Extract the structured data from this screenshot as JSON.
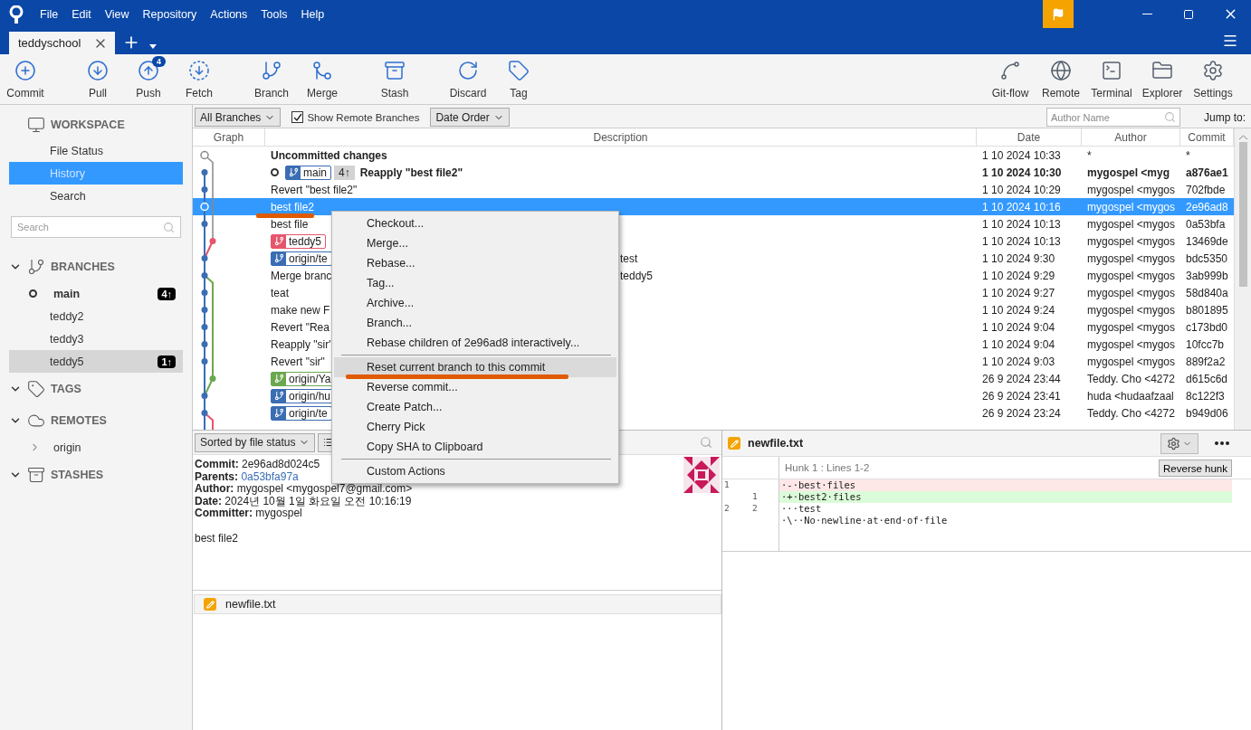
{
  "window": {
    "menu": [
      "File",
      "Edit",
      "View",
      "Repository",
      "Actions",
      "Tools",
      "Help"
    ],
    "tabs": [
      {
        "label": "teddyschool",
        "selected": true
      }
    ]
  },
  "toolbar": {
    "left": [
      {
        "label": "Commit"
      },
      {
        "label": "Pull"
      },
      {
        "label": "Push",
        "badge": "4"
      },
      {
        "label": "Fetch"
      },
      {
        "label": "Branch"
      },
      {
        "label": "Merge"
      },
      {
        "label": "Stash"
      },
      {
        "label": "Discard"
      },
      {
        "label": "Tag"
      }
    ],
    "right": [
      {
        "label": "Git-flow"
      },
      {
        "label": "Remote"
      },
      {
        "label": "Terminal"
      },
      {
        "label": "Explorer"
      },
      {
        "label": "Settings"
      }
    ]
  },
  "sidebar": {
    "workspace": {
      "title": "WORKSPACE",
      "items": [
        {
          "label": "File Status",
          "selected": false
        },
        {
          "label": "History",
          "selected": true
        },
        {
          "label": "Search",
          "selected": false
        }
      ]
    },
    "search": {
      "placeholder": "Search"
    },
    "sections": [
      {
        "title": "BRANCHES",
        "expanded": true,
        "items": [
          {
            "label": "main",
            "current": true,
            "selected": false,
            "badge": "4↑"
          },
          {
            "label": "teddy2",
            "current": false,
            "selected": false
          },
          {
            "label": "teddy3",
            "current": false,
            "selected": false
          },
          {
            "label": "teddy5",
            "current": false,
            "selected": true,
            "badge": "1↑"
          }
        ]
      },
      {
        "title": "TAGS",
        "expanded": true
      },
      {
        "title": "REMOTES",
        "expanded": true,
        "items": [
          {
            "label": "origin",
            "expanded": false
          }
        ]
      },
      {
        "title": "STASHES",
        "expanded": true
      }
    ]
  },
  "history": {
    "filters": {
      "branches": "All Branches",
      "show_remote": {
        "label": "Show Remote Branches",
        "checked": true
      },
      "order": "Date Order",
      "author": {
        "placeholder": "Author Name"
      },
      "jump_label": "Jump to:"
    },
    "columns": [
      "Graph",
      "Description",
      "Date",
      "Author",
      "Commit"
    ],
    "rows": [
      {
        "kind": "uncommitted",
        "selected": false,
        "description": "Uncommitted changes",
        "date": "1 10 2024 10:33",
        "author": "*",
        "commit": "*"
      },
      {
        "kind": "head",
        "selected": false,
        "refs": [
          {
            "kind": "branch",
            "label": "main",
            "color": "#3b6db3"
          },
          {
            "kind": "count",
            "label": "4↑"
          }
        ],
        "description": "Reapply \"best file2\"",
        "date": "1 10 2024 10:30",
        "author": "mygospel <myg",
        "commit": "a876ae1"
      },
      {
        "kind": "commit",
        "selected": false,
        "description": "Revert \"best file2\"",
        "date": "1 10 2024 10:29",
        "author": "mygospel <mygos",
        "commit": "702fbde"
      },
      {
        "kind": "commit",
        "selected": true,
        "description": "best file2",
        "date": "1 10 2024 10:16",
        "author": "mygospel <mygos",
        "commit": "2e96ad8"
      },
      {
        "kind": "commit",
        "selected": false,
        "description": "best file",
        "date": "1 10 2024 10:13",
        "author": "mygospel <mygos",
        "commit": "0a53bfa"
      },
      {
        "kind": "commit",
        "selected": false,
        "refs": [
          {
            "kind": "branch",
            "label": "teddy5",
            "color": "#e4566c"
          }
        ],
        "date": "1 10 2024 10:13",
        "author": "mygospel <mygos",
        "commit": "13469de"
      },
      {
        "kind": "commit",
        "selected": false,
        "refs": [
          {
            "kind": "branch",
            "label": "origin/te",
            "color": "#3b6db3"
          }
        ],
        "tail": "test",
        "date": "1 10 2024 9:30",
        "author": "mygospel <mygos",
        "commit": "bdc5350"
      },
      {
        "kind": "commit",
        "selected": false,
        "description": "Merge branc",
        "tail": "teddy5",
        "date": "1 10 2024 9:29",
        "author": "mygospel <mygos",
        "commit": "3ab999b"
      },
      {
        "kind": "commit",
        "selected": false,
        "description": "teat",
        "date": "1 10 2024 9:27",
        "author": "mygospel <mygos",
        "commit": "58d840a"
      },
      {
        "kind": "commit",
        "selected": false,
        "description": "make new F",
        "date": "1 10 2024 9:24",
        "author": "mygospel <mygos",
        "commit": "b801895"
      },
      {
        "kind": "commit",
        "selected": false,
        "description": "Revert \"Rea",
        "date": "1 10 2024 9:04",
        "author": "mygospel <mygos",
        "commit": "c173bd0"
      },
      {
        "kind": "commit",
        "selected": false,
        "description": "Reapply \"sir\"",
        "date": "1 10 2024 9:04",
        "author": "mygospel <mygos",
        "commit": "10fcc7b"
      },
      {
        "kind": "commit",
        "selected": false,
        "description": "Revert \"sir\"",
        "date": "1 10 2024 9:03",
        "author": "mygospel <mygos",
        "commit": "889f2a2"
      },
      {
        "kind": "commit",
        "selected": false,
        "refs": [
          {
            "kind": "branch",
            "label": "origin/Ya",
            "color": "#6aa84f"
          }
        ],
        "date": "26 9 2024 23:44",
        "author": "Teddy. Cho <4272",
        "commit": "d615c6d"
      },
      {
        "kind": "commit",
        "selected": false,
        "refs": [
          {
            "kind": "branch",
            "label": "origin/hu",
            "color": "#3b6db3"
          }
        ],
        "date": "26 9 2024 23:41",
        "author": "huda <hudaafzaal",
        "commit": "8c122f3"
      },
      {
        "kind": "commit",
        "selected": false,
        "refs": [
          {
            "kind": "branch",
            "label": "origin/te",
            "color": "#3b6db3"
          }
        ],
        "date": "26 9 2024 23:24",
        "author": "Teddy. Cho <4272",
        "commit": "b949d06"
      }
    ]
  },
  "context_menu": {
    "items": [
      {
        "kind": "item",
        "label": "Checkout...",
        "highlighted": false
      },
      {
        "kind": "item",
        "label": "Merge...",
        "highlighted": false
      },
      {
        "kind": "item",
        "label": "Rebase...",
        "highlighted": false
      },
      {
        "kind": "item",
        "label": "Tag...",
        "highlighted": false
      },
      {
        "kind": "item",
        "label": "Archive...",
        "highlighted": false
      },
      {
        "kind": "item",
        "label": "Branch...",
        "highlighted": false
      },
      {
        "kind": "item",
        "label": "Rebase children of 2e96ad8 interactively...",
        "highlighted": false
      },
      {
        "kind": "separator"
      },
      {
        "kind": "item",
        "label": "Reset current branch to this commit",
        "highlighted": true
      },
      {
        "kind": "item",
        "label": "Reverse commit...",
        "highlighted": false
      },
      {
        "kind": "item",
        "label": "Create Patch...",
        "highlighted": false
      },
      {
        "kind": "item",
        "label": "Cherry Pick",
        "highlighted": false
      },
      {
        "kind": "item",
        "label": "Copy SHA to Clipboard",
        "highlighted": false
      },
      {
        "kind": "separator"
      },
      {
        "kind": "item",
        "label": "Custom Actions",
        "highlighted": false
      }
    ]
  },
  "details": {
    "sort": "Sorted by file status",
    "fields": [
      {
        "kind": "text",
        "label": "Commit:",
        "value": "2e96ad8d024c5"
      },
      {
        "kind": "link",
        "label": "Parents:",
        "value": "0a53bfa97a"
      },
      {
        "kind": "text",
        "label": "Author:",
        "value": "mygospel <mygospel7@gmail.com>"
      },
      {
        "kind": "text",
        "label": "Date:",
        "value": "2024년 10월 1일 화요일 오전 10:16:19"
      },
      {
        "kind": "text",
        "label": "Committer:",
        "value": "mygospel"
      }
    ],
    "message": "best file2",
    "files": [
      {
        "name": "newfile.txt",
        "selected": false
      }
    ]
  },
  "diff": {
    "file": "newfile.txt",
    "hunk": "Hunk 1 : Lines 1-2",
    "reverse_button": "Reverse hunk",
    "lines": [
      {
        "kind": "removed",
        "old": "1",
        "text": "·-·best·files"
      },
      {
        "kind": "added",
        "new": "1",
        "text": "·+·best2·files"
      },
      {
        "kind": "context",
        "old": "2",
        "new": "2",
        "text": "···test"
      },
      {
        "kind": "note",
        "text": "·\\··No·newline·at·end·of·file"
      }
    ]
  }
}
